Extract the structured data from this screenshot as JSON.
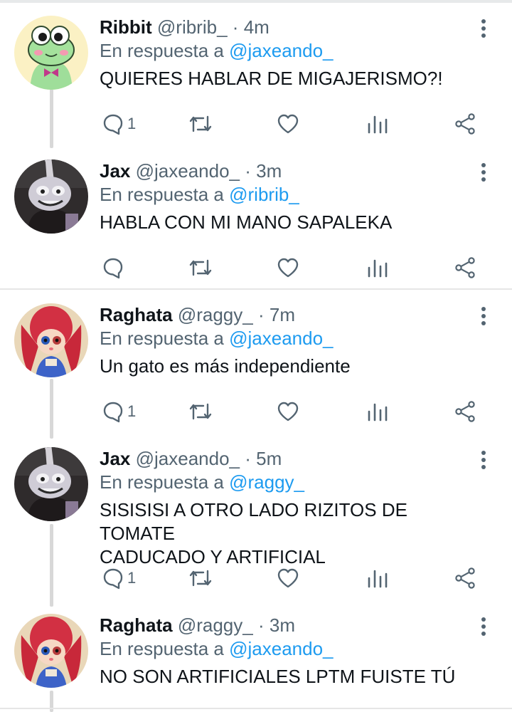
{
  "reply_prefix": "En respuesta a",
  "colors": {
    "accent": "#1d9bf0",
    "muted": "#536471",
    "text": "#0f1419"
  },
  "icons": [
    "reply-icon",
    "retweet-icon",
    "like-icon",
    "stats-icon",
    "share-icon",
    "more-icon"
  ],
  "tweets": [
    {
      "name": "Ribbit",
      "handle": "@ribrib_",
      "dot": "·",
      "time": "4m",
      "reply_to": "@jaxeando_",
      "text": "QUIERES HABLAR DE MIGAJERISMO?!",
      "replies": "1"
    },
    {
      "name": "Jax",
      "handle": "@jaxeando_",
      "dot": "·",
      "time": "3m",
      "reply_to": "@ribrib_",
      "text": "HABLA CON MI MANO SAPALEKA",
      "replies": ""
    },
    {
      "name": "Raghata",
      "handle": "@raggy_",
      "dot": "·",
      "time": "7m",
      "reply_to": "@jaxeando_",
      "text": "Un gato es más independiente",
      "replies": "1"
    },
    {
      "name": "Jax",
      "handle": "@jaxeando_",
      "dot": "·",
      "time": "5m",
      "reply_to": "@raggy_",
      "text": "SISISISI A OTRO LADO RIZITOS DE TOMATE\nCADUCADO Y ARTIFICIAL",
      "replies": "1"
    },
    {
      "name": "Raghata",
      "handle": "@raggy_",
      "dot": "·",
      "time": "3m",
      "reply_to": "@jaxeando_",
      "text": "NO SON ARTIFICIALES LPTM FUISTE TÚ",
      "replies": ""
    }
  ]
}
